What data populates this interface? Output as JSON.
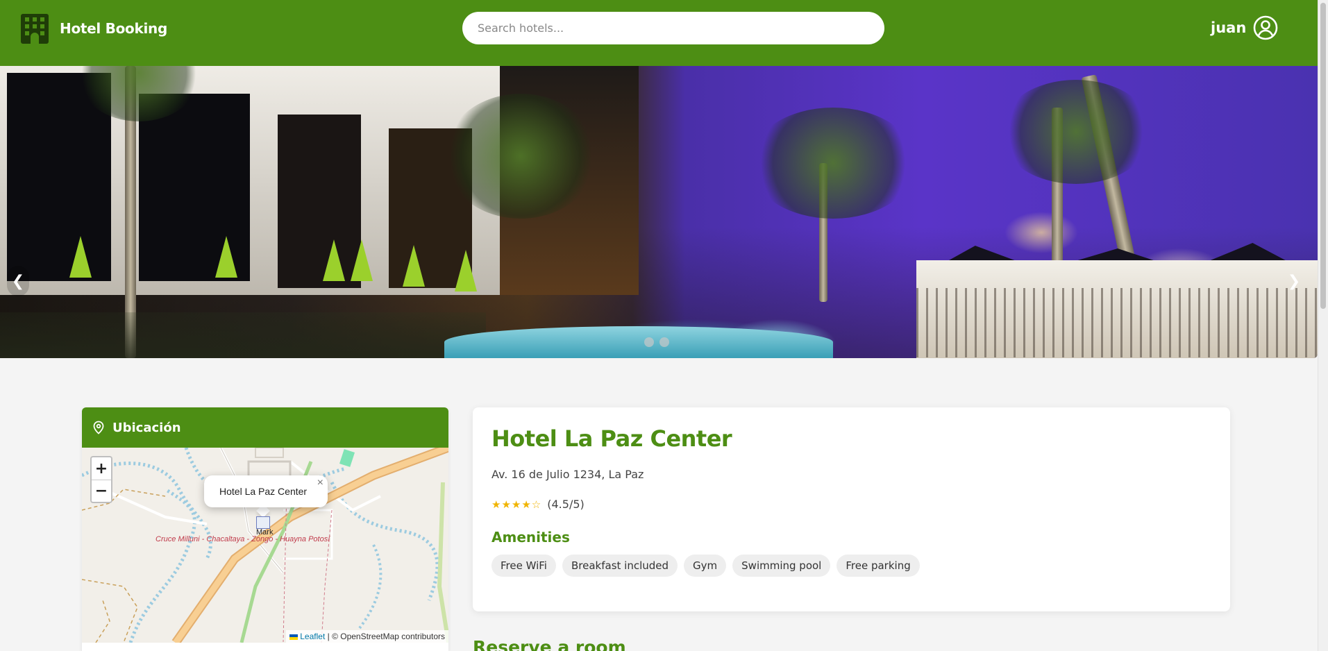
{
  "header": {
    "brand": "Hotel Booking",
    "brand_icon": "building-icon",
    "search_placeholder": "Search hotels...",
    "user_name": "juan",
    "user_icon": "user-circle-icon"
  },
  "carousel": {
    "prev_label": "❮",
    "next_label": "❯",
    "slides": 2,
    "active_slide": 1
  },
  "location": {
    "title": "Ubicación",
    "icon": "map-pin-icon",
    "zoom_in": "+",
    "zoom_out": "−",
    "popup_text": "Hotel La Paz Center",
    "popup_close": "×",
    "marker_label": "Mark",
    "road_label": "Cruce Milluni - Chacaltaya - Zongo - Huayna Potosí",
    "attribution_leaflet": "Leaflet",
    "attribution_rest": " | © OpenStreetMap contributors"
  },
  "hotel": {
    "name": "Hotel La Paz Center",
    "address": "Av. 16 de Julio 1234, La Paz",
    "stars": "★★★★☆",
    "rating": 4.5,
    "rating_text": "(4.5/5)",
    "amenities_title": "Amenities",
    "amenities": [
      "Free WiFi",
      "Breakfast included",
      "Gym",
      "Swimming pool",
      "Free parking"
    ]
  },
  "reserve_title": "Reserve a room",
  "colors": {
    "brand_green": "#4d8e14",
    "star": "#f0b400",
    "chip_bg": "#eeeeee"
  }
}
